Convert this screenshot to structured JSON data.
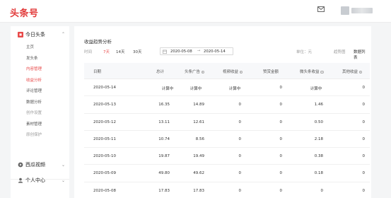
{
  "app": {
    "logo_text": "头条号"
  },
  "header": {
    "mail_icon": "mail-icon",
    "avatar": "avatar"
  },
  "sidebar": {
    "section_main": "今日头条",
    "section_main_icon": "toutiao-icon",
    "items": [
      {
        "label": "主页",
        "state": "normal"
      },
      {
        "label": "发头条",
        "state": "normal"
      },
      {
        "label": "内容管理",
        "state": "active"
      },
      {
        "label": "收益分析",
        "state": "active"
      },
      {
        "label": "评论管理",
        "state": "normal"
      },
      {
        "label": "数据分析",
        "state": "normal"
      },
      {
        "label": "创作设置",
        "state": "muted"
      },
      {
        "label": "素材管理",
        "state": "normal"
      },
      {
        "label": "原创保护",
        "state": "muted"
      }
    ],
    "section_video": "西瓜视频",
    "section_profile": "个人中心"
  },
  "panel": {
    "title": "收益趋势分析",
    "time_label": "时间",
    "range_options": [
      "7天",
      "14天",
      "30天"
    ],
    "active_range": "7天",
    "date_start": "2020-05-08",
    "date_sep": "→",
    "date_end": "2020-05-14",
    "unit_label": "单位：元",
    "view_trend": "趋势图",
    "view_list": "数据列表"
  },
  "table": {
    "headers": [
      "日期",
      "总计",
      "头条广告",
      "视频收益",
      "赞赏金额",
      "微头条收益",
      "其他收益"
    ],
    "rows": [
      [
        "2020-05-14",
        "计算中",
        "计算中",
        "计算中",
        "0",
        "计算中",
        "0"
      ],
      [
        "2020-05-13",
        "16.35",
        "14.89",
        "0",
        "0",
        "1.46",
        "0"
      ],
      [
        "2020-05-12",
        "13.11",
        "12.61",
        "0",
        "0",
        "0.50",
        "0"
      ],
      [
        "2020-05-11",
        "10.74",
        "8.56",
        "0",
        "0",
        "2.18",
        "0"
      ],
      [
        "2020-05-10",
        "19.87",
        "19.49",
        "0",
        "0",
        "0.38",
        "0"
      ],
      [
        "2020-05-09",
        "49.80",
        "49.62",
        "0",
        "0",
        "0.18",
        "0"
      ],
      [
        "2020-05-08",
        "17.83",
        "17.83",
        "0",
        "0",
        "0",
        "0"
      ]
    ]
  },
  "colors": {
    "accent": "#e84a4a",
    "logo": "#e23a3a",
    "background": "#f4f5f6"
  }
}
